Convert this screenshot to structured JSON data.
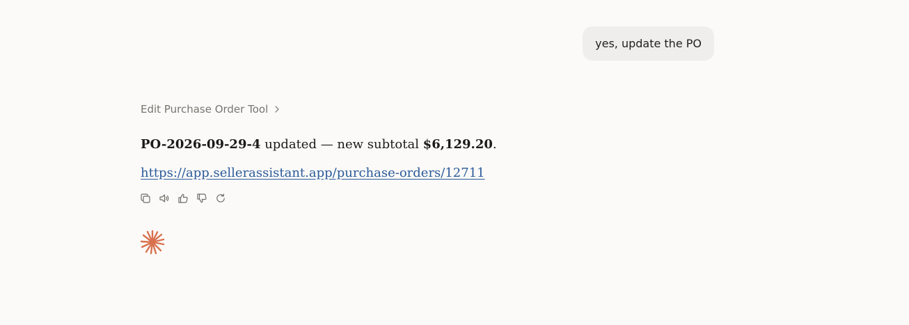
{
  "user_message": {
    "text": "yes, update the PO"
  },
  "tool_call": {
    "label": "Edit Purchase Order Tool",
    "chevron_icon": "chevron-right-icon"
  },
  "response": {
    "po_number": "PO-2026-09-29-4",
    "text_middle": " updated — new subtotal ",
    "subtotal": "$6,129.20",
    "text_end": ".",
    "link": "https://app.sellerassistant.app/purchase-orders/12711"
  },
  "actions": {
    "icons": [
      "copy-icon",
      "speaker-icon",
      "thumbs-up-icon",
      "thumbs-down-icon",
      "retry-icon"
    ]
  },
  "colors": {
    "background": "#fbfaf8",
    "user_bubble": "#efeeec",
    "link": "#2b5a9a",
    "spark": "#d9714f",
    "muted_text": "#77756f"
  },
  "spark_icon": "sparkle-asterisk-icon"
}
